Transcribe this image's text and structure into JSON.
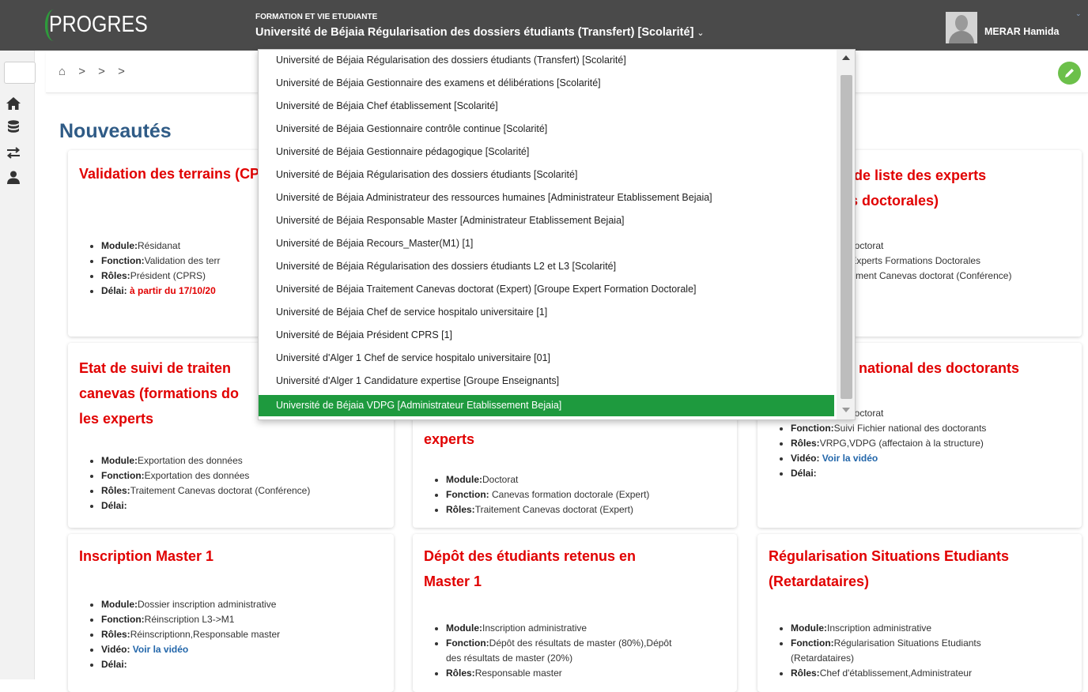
{
  "header": {
    "logo_text": "PROGRES",
    "context_subtitle": "FORMATION ET VIE ETUDIANTE",
    "context_title": "Université de Béjaia Régularisation des dossiers étudiants (Transfert) [Scolarité]",
    "caret": "⌄",
    "user_name": "MERAR Hamida",
    "user_caret": "⌄"
  },
  "sidebar": {
    "icons": [
      "home-icon",
      "database-icon",
      "exchange-icon",
      "user-icon"
    ]
  },
  "breadcrumb": {
    "text": "⌂ > > >"
  },
  "main": {
    "title": "Nouveautés"
  },
  "cards": {
    "c1": {
      "title": "Validation des terrains (CPRS)",
      "module_label": "Module:",
      "module": "Résidanat",
      "fonction_label": "Fonction:",
      "fonction": "Validation des terr",
      "roles_label": "Rôles:",
      "roles": "Président (CPRS)",
      "delai_label": "Délai:",
      "delai": "à partir du 17/10/20"
    },
    "c2": {
      "title": "n de liste des experts",
      "title2": "ns doctorales)",
      "l1": "Doctorat",
      "l2": ":Experts Formations Doctorales",
      "l3": "tement Canevas doctorat (Conférence)"
    },
    "c3": {
      "title1": "Etat de suivi de traiten",
      "title2": "canevas (formations do",
      "title3": "les experts",
      "module_label": "Module:",
      "module": "Exportation des données",
      "fonction_label": "Fonction:",
      "fonction": "Exportation des données",
      "roles_label": "Rôles:",
      "roles": "Traitement Canevas doctorat (Conférence)",
      "delai_label": "Délai:"
    },
    "c4": {
      "title": "experts",
      "module_label": "Module:",
      "module": "Doctorat",
      "fonction_label": "Fonction:",
      "fonction": " Canevas formation doctorale (Expert)",
      "roles_label": "Rôles:",
      "roles": "Traitement Canevas doctorat (Expert)"
    },
    "c5": {
      "title": "er national des doctorants",
      "l1": "Doctorat",
      "fonction_label": "Fonction:",
      "fonction": "Suivi Fichier national des doctorants",
      "roles_label": "Rôles:",
      "roles": "VRPG,VDPG (affectaion à la structure)",
      "video_label": "Vidéo:",
      "video": "Voir la vidéo",
      "delai_label": "Délai:"
    },
    "c6": {
      "title": "Inscription Master 1",
      "module_label": "Module:",
      "module": "Dossier inscription administrative",
      "fonction_label": "Fonction:",
      "fonction": "Réinscription L3->M1",
      "roles_label": "Rôles:",
      "roles": "Réinscriptionn,Responsable master",
      "video_label": "Vidéo:",
      "video": "Voir la vidéo",
      "delai_label": "Délai:"
    },
    "c7": {
      "title1": "Dépôt des étudiants retenus en",
      "title2": "Master 1",
      "module_label": "Module:",
      "module": "Inscription administrative",
      "fonction_label": "Fonction:",
      "fonction": "Dépôt des résultats de master (80%),Dépôt",
      "fonction2": "des résultats de master (20%)",
      "roles_label": "Rôles:",
      "roles": "Responsable master"
    },
    "c8": {
      "title1": "Régularisation Situations Etudiants",
      "title2": "(Retardataires)",
      "module_label": "Module:",
      "module": "Inscription administrative",
      "fonction_label": "Fonction:",
      "fonction": "Régularisation Situations Etudiants",
      "fonction2": "(Retardataires)",
      "roles_label": "Rôles:",
      "roles": "Chef d'établissement,Administrateur"
    }
  },
  "dropdown": {
    "items": [
      "Université de Béjaia Régularisation des dossiers étudiants (Transfert) [Scolarité]",
      "Université de Béjaia Gestionnaire des examens et délibérations [Scolarité]",
      "Université de Béjaia Chef établissement [Scolarité]",
      "Université de Béjaia Gestionnaire contrôle continue [Scolarité]",
      "Université de Béjaia Gestionnaire pédagogique [Scolarité]",
      "Université de Béjaia Régularisation des dossiers étudiants [Scolarité]",
      "Université de Béjaia Administrateur des ressources humaines [Administrateur Etablissement Bejaia]",
      "Université de Béjaia Responsable Master [Administrateur Etablissement Bejaia]",
      "Université de Béjaia Recours_Master(M1) [1]",
      "Université de Béjaia Régularisation des dossiers étudiants L2 et L3 [Scolarité]",
      "Université de Béjaia Traitement Canevas doctorat (Expert) [Groupe Expert Formation Doctorale]",
      "Université de Béjaia Chef de service hospitalo universitaire [1]",
      "Université de Béjaia Président CPRS [1]",
      "Université d'Alger 1 Chef de service hospitalo universitaire [01]",
      "Université d'Alger 1 Candidature expertise [Groupe Enseignants]",
      "Université de Béjaia VDPG [Administrateur Etablissement Bejaia]"
    ],
    "selected_index": 15
  },
  "colors": {
    "topbar": "#4a4a4a",
    "accent_green": "#1e9a3e",
    "title_red": "#e10000",
    "heading_blue": "#2f5b86"
  }
}
